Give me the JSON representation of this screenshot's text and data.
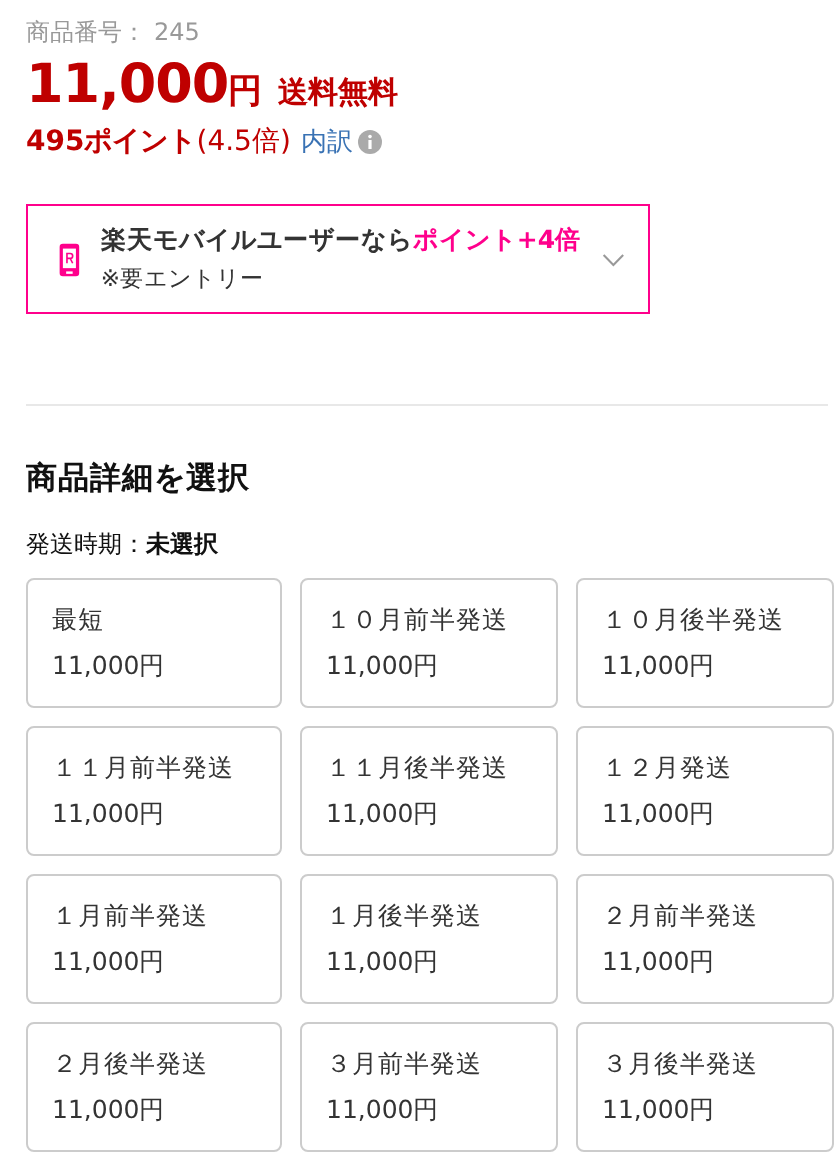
{
  "item_number": {
    "label": "商品番号：",
    "value": "245"
  },
  "price": {
    "amount": "11,000",
    "unit": "円",
    "shipping": "送料無料"
  },
  "points": {
    "amount": "495ポイント",
    "rate": "(4.5倍)",
    "breakdown_link": "内訳"
  },
  "promo": {
    "text": "楽天モバイルユーザーなら",
    "highlight": "ポイント+4倍",
    "note": "※要エントリー",
    "expanded": false
  },
  "selector": {
    "title": "商品詳細を選択",
    "field_label": "発送時期：",
    "field_value": "未選択",
    "options": [
      {
        "label": "最短",
        "price": "11,000円",
        "selected": false
      },
      {
        "label": "１０月前半発送",
        "price": "11,000円",
        "selected": false
      },
      {
        "label": "１０月後半発送",
        "price": "11,000円",
        "selected": false
      },
      {
        "label": "１１月前半発送",
        "price": "11,000円",
        "selected": false
      },
      {
        "label": "１１月後半発送",
        "price": "11,000円",
        "selected": false
      },
      {
        "label": "１２月発送",
        "price": "11,000円",
        "selected": false
      },
      {
        "label": "１月前半発送",
        "price": "11,000円",
        "selected": false
      },
      {
        "label": "１月後半発送",
        "price": "11,000円",
        "selected": false
      },
      {
        "label": "２月前半発送",
        "price": "11,000円",
        "selected": false
      },
      {
        "label": "２月後半発送",
        "price": "11,000円",
        "selected": false
      },
      {
        "label": "３月前半発送",
        "price": "11,000円",
        "selected": false
      },
      {
        "label": "３月後半発送",
        "price": "11,000円",
        "selected": false
      }
    ]
  }
}
